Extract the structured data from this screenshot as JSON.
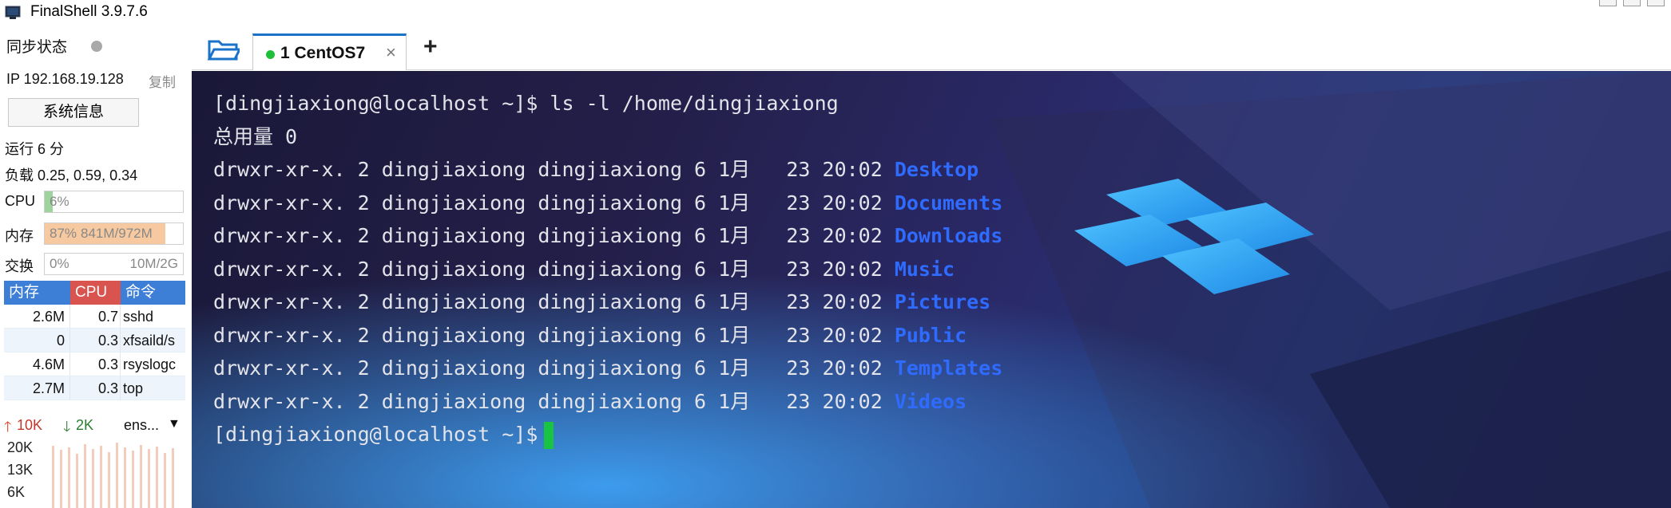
{
  "app": {
    "title": "FinalShell 3.9.7.6"
  },
  "sidebar": {
    "sync_label": "同步状态",
    "ip_text": "IP 192.168.19.128",
    "copy_label": "复制",
    "sysinfo_button": "系统信息",
    "uptime_text": "运行 6 分",
    "load_text": "负载 0.25, 0.59, 0.34",
    "cpu": {
      "label": "CPU",
      "value_text": "6%",
      "fraction": 0.06
    },
    "memory": {
      "label": "内存",
      "percent_text": "87%",
      "usage_text": "841M/972M",
      "fraction": 0.87
    },
    "swap": {
      "label": "交换",
      "percent_text": "0%",
      "usage_text": "10M/2G",
      "fraction": 0.0
    },
    "process_table": {
      "headers": [
        "内存",
        "CPU",
        "命令"
      ],
      "rows": [
        {
          "mem": "2.6M",
          "cpu": "0.7",
          "cmd": "sshd"
        },
        {
          "mem": "0",
          "cpu": "0.3",
          "cmd": "xfsaild/s"
        },
        {
          "mem": "4.6M",
          "cpu": "0.3",
          "cmd": "rsyslogc"
        },
        {
          "mem": "2.7M",
          "cpu": "0.3",
          "cmd": "top"
        }
      ]
    },
    "network": {
      "up_text": "10K",
      "down_text": "2K",
      "interface": "ens...",
      "y_labels": [
        "20K",
        "13K",
        "6K"
      ]
    }
  },
  "tabs": {
    "items": [
      {
        "label": "1 CentOS7",
        "status": "connected"
      }
    ],
    "close_symbol": "×",
    "add_symbol": "+"
  },
  "terminal": {
    "command_line": "[dingjiaxiong@localhost ~]$ ls -l /home/dingjiaxiong",
    "total_line": "总用量 0",
    "entries": [
      {
        "meta": "drwxr-xr-x. 2 dingjiaxiong dingjiaxiong 6 1月   23 20:02 ",
        "name": "Desktop"
      },
      {
        "meta": "drwxr-xr-x. 2 dingjiaxiong dingjiaxiong 6 1月   23 20:02 ",
        "name": "Documents"
      },
      {
        "meta": "drwxr-xr-x. 2 dingjiaxiong dingjiaxiong 6 1月   23 20:02 ",
        "name": "Downloads"
      },
      {
        "meta": "drwxr-xr-x. 2 dingjiaxiong dingjiaxiong 6 1月   23 20:02 ",
        "name": "Music"
      },
      {
        "meta": "drwxr-xr-x. 2 dingjiaxiong dingjiaxiong 6 1月   23 20:02 ",
        "name": "Pictures"
      },
      {
        "meta": "drwxr-xr-x. 2 dingjiaxiong dingjiaxiong 6 1月   23 20:02 ",
        "name": "Public"
      },
      {
        "meta": "drwxr-xr-x. 2 dingjiaxiong dingjiaxiong 6 1月   23 20:02 ",
        "name": "Templates"
      },
      {
        "meta": "drwxr-xr-x. 2 dingjiaxiong dingjiaxiong 6 1月   23 20:02 ",
        "name": "Videos"
      }
    ],
    "prompt": "[dingjiaxiong@localhost ~]$"
  },
  "colors": {
    "cpu_fill": "#9ed39e",
    "mem_fill": "#f7c9a0",
    "proc_head_mem": "#3d7fd6",
    "proc_head_cpu": "#d9534f",
    "proc_head_cmd": "#3d7fd6",
    "dir_color": "#2f6bff",
    "cursor": "#18c442"
  }
}
